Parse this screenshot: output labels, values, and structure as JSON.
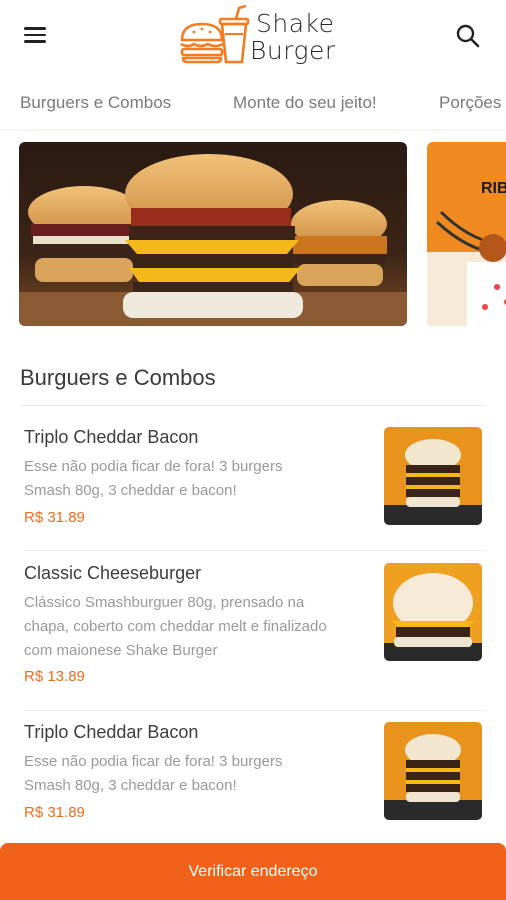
{
  "header": {
    "logo": {
      "line1": "Shake",
      "line2": "Burger"
    },
    "icons": {
      "menu": "hamburger-menu-icon",
      "search": "search-icon"
    }
  },
  "tabs": [
    {
      "label": "Burguers e Combos"
    },
    {
      "label": "Monte do seu jeito!"
    },
    {
      "label": "Porções"
    }
  ],
  "banners": {
    "second_banner_text": "RIB"
  },
  "section": {
    "title": "Burguers e Combos"
  },
  "items": [
    {
      "name": "Triplo Cheddar Bacon",
      "desc_lines": [
        "Esse não podia ficar de fora! 3 burgers",
        "Smash 80g, 3 cheddar e bacon!"
      ],
      "price": "R$ 31.89"
    },
    {
      "name": "Classic Cheeseburger",
      "desc_lines": [
        "Clássico Smashburguer 80g, prensado na",
        "chapa, coberto com cheddar melt e finalizado",
        "com maionese Shake Burger"
      ],
      "price": "R$ 13.89"
    },
    {
      "name": "Triplo Cheddar Bacon",
      "desc_lines": [
        "Esse não podia ficar de fora! 3 burgers",
        "Smash 80g, 3 cheddar e bacon!"
      ],
      "price": "R$ 31.89"
    }
  ],
  "cta": {
    "label": "Verificar endereço"
  },
  "colors": {
    "accent": "#f06219",
    "price": "#f06a1c",
    "logo_orange": "#f47b20"
  }
}
